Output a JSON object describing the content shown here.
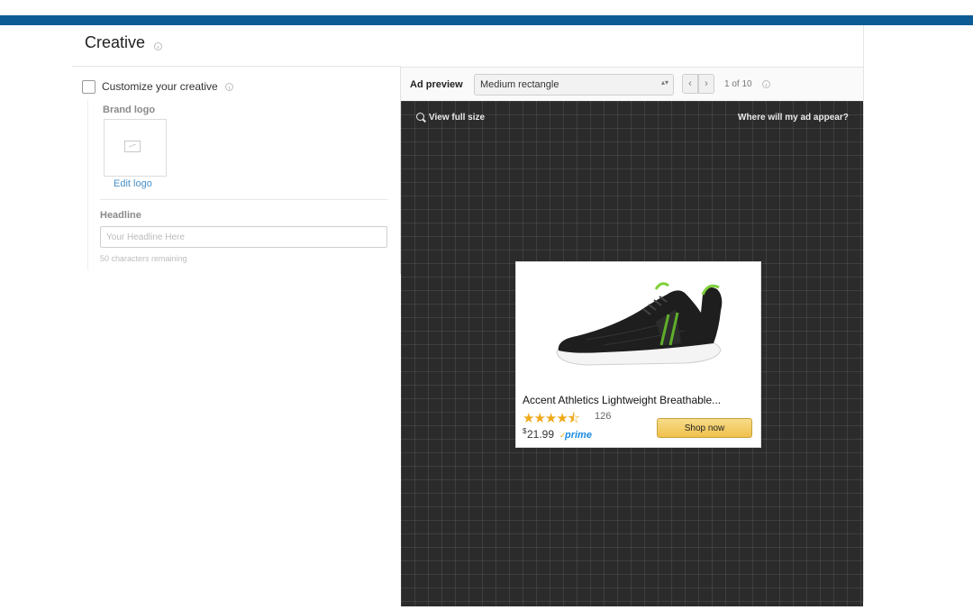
{
  "page": {
    "title": "Creative"
  },
  "customize": {
    "label": "Customize your creative",
    "checked": false
  },
  "brand_logo": {
    "label": "Brand logo",
    "edit_label": "Edit logo"
  },
  "headline": {
    "label": "Headline",
    "value": "",
    "placeholder": "Your Headline Here",
    "remaining": "50 characters remaining"
  },
  "preview": {
    "label": "Ad preview",
    "size_selected": "Medium rectangle",
    "pagination": "1 of 10",
    "view_full": "View full size",
    "where_appear": "Where will my ad appear?"
  },
  "ad": {
    "product_title": "Accent Athletics Lightweight Breathable...",
    "rating_stars": 4.5,
    "stars_text": "★★★★⯪",
    "review_count": "126",
    "price_currency": "$",
    "price": "21.99",
    "prime": "prime",
    "shop_button": "Shop now"
  },
  "icons": {
    "nav_prev": "‹",
    "nav_next": "›",
    "select_arrow": "▴▾"
  },
  "colors": {
    "top_bar": "#0e5c95",
    "link": "#4a90c8",
    "canvas": "#2b2b2b",
    "star": "#f0a818",
    "prime": "#1a8ae0",
    "shop_button": "#f0c04a"
  }
}
